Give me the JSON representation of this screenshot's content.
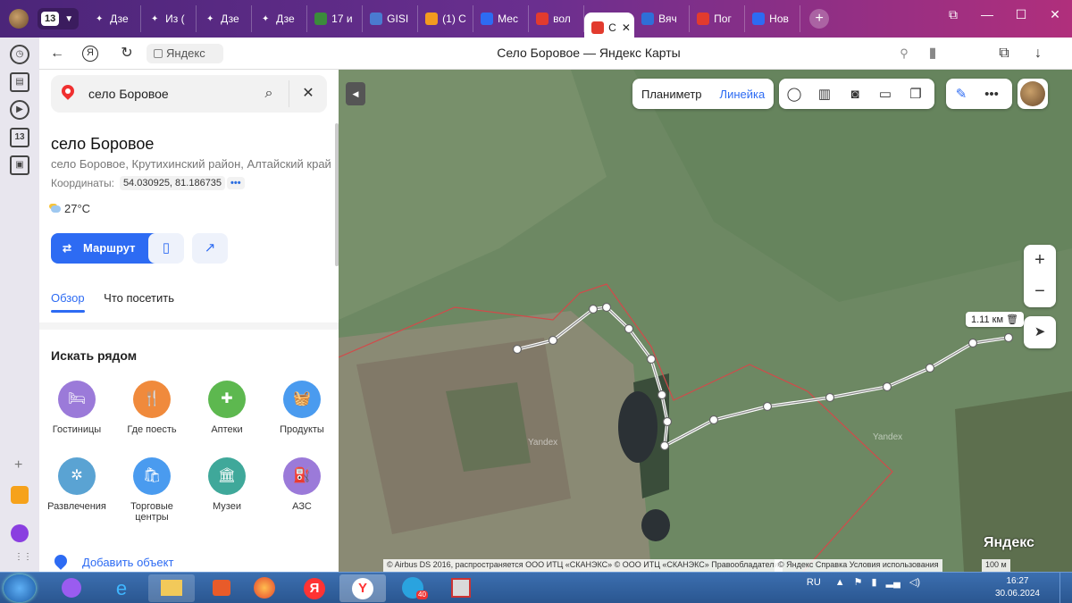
{
  "browser": {
    "tab_count": "13",
    "tabs": [
      {
        "label": "Дзе",
        "icon": "sparkle-icon",
        "color": "#ffffff"
      },
      {
        "label": "Из (",
        "icon": "sparkle-icon",
        "color": "#ffffff"
      },
      {
        "label": "Дзе",
        "icon": "sparkle-icon",
        "color": "#ffffff"
      },
      {
        "label": "Дзе",
        "icon": "sparkle-icon",
        "color": "#ffffff"
      },
      {
        "label": "17 и",
        "icon": "game-icon",
        "color": "#3b8b3b"
      },
      {
        "label": "GISI",
        "icon": "g-icon",
        "color": "#4a7bd0"
      },
      {
        "label": "(1) С",
        "icon": "ok-icon",
        "color": "#f39a1f"
      },
      {
        "label": "Мес",
        "icon": "chat-icon",
        "color": "#2d6bf3"
      },
      {
        "label": "вол",
        "icon": "yandex-icon",
        "color": "#e23b2e"
      },
      {
        "label": "С",
        "icon": "maps-pin-icon",
        "color": "#e23b2e",
        "active": true
      },
      {
        "label": "Вяч",
        "icon": "vk-icon",
        "color": "#2f6fd8"
      },
      {
        "label": "Пог",
        "icon": "weather-icon",
        "color": "#e23b2e"
      },
      {
        "label": "Нов",
        "icon": "news-icon",
        "color": "#2d6bf3"
      }
    ],
    "address": "Яндекс",
    "page_title": "Село Боровое — Яндекс Карты"
  },
  "panel": {
    "search_value": "село Боровое",
    "title": "село Боровое",
    "subtitle": "село Боровое, Крутихинский район, Алтайский край",
    "coords_label": "Координаты:",
    "coords_value": "54.030925, 81.186735",
    "coords_more": "•••",
    "temperature": "27°C",
    "route_label": "Маршрут",
    "tabs": [
      "Обзор",
      "Что посетить"
    ],
    "nearby_title": "Искать рядом",
    "categories": [
      {
        "label": "Гостиницы",
        "icon": "bed-icon",
        "color": "#9b7ad9"
      },
      {
        "label": "Где поесть",
        "icon": "fork-knife-icon",
        "color": "#f08a3c"
      },
      {
        "label": "Аптеки",
        "icon": "pharmacy-cross-icon",
        "color": "#5db84f"
      },
      {
        "label": "Продукты",
        "icon": "basket-icon",
        "color": "#4a9bef"
      },
      {
        "label": "Развлечения",
        "icon": "ferris-wheel-icon",
        "color": "#5aa3d3"
      },
      {
        "label": "Торговые центры",
        "icon": "shopping-bag-icon",
        "color": "#4a9bef"
      },
      {
        "label": "Музеи",
        "icon": "museum-icon",
        "color": "#3fa89a"
      },
      {
        "label": "АЗС",
        "icon": "fuel-icon",
        "color": "#9b7ad9"
      }
    ],
    "add_object": "Добавить объект"
  },
  "map": {
    "tools": [
      "Планиметр",
      "Линейка"
    ],
    "distance": "1.11 км",
    "logo": "Яндекс",
    "watermark": "Yandex",
    "copyright": "© Airbus DS 2016, распространяется ООО ИТЦ «СКАНЭКС» © ООО ИТЦ «СКАНЭКС»  Правообладатели",
    "links": "© Яндекс   Справка   Условия использования",
    "scale": "100 м"
  },
  "taskbar": {
    "lang": "RU",
    "time": "16:27",
    "date": "30.06.2024",
    "badge": "40"
  }
}
